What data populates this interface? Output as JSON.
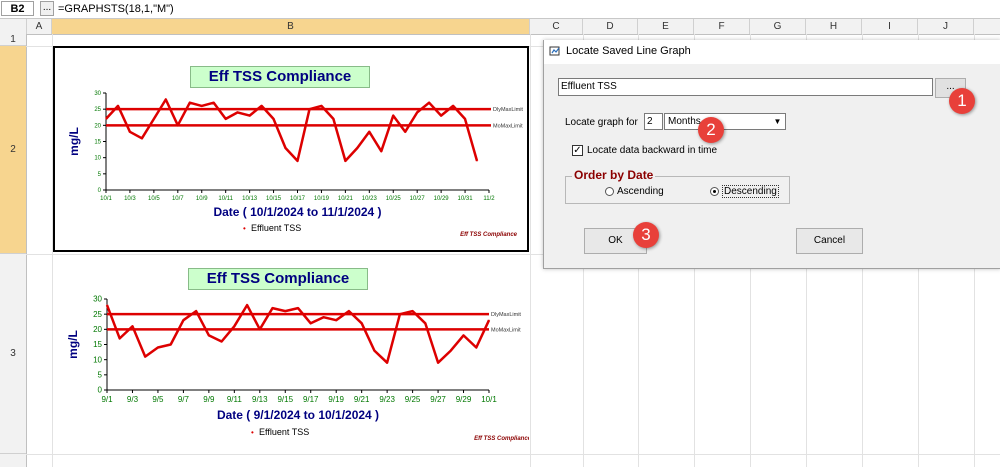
{
  "formula_bar": {
    "cell_ref": "B2",
    "button_label": "...",
    "formula": "=GRAPHSTS(18,1,\"M\")"
  },
  "columns": [
    "A",
    "B",
    "C",
    "D",
    "E",
    "F",
    "G",
    "H",
    "I",
    "J"
  ],
  "rows": [
    "1",
    "2",
    "3"
  ],
  "chart_data": [
    {
      "type": "line",
      "title": "Eff TSS Compliance",
      "xlabel": "Date  ( 10/1/2024  to  11/1/2024 )",
      "ylabel": "mg/L",
      "x_ticks": [
        "10/1",
        "10/3",
        "10/5",
        "10/7",
        "10/9",
        "10/11",
        "10/13",
        "10/15",
        "10/17",
        "10/19",
        "10/21",
        "10/23",
        "10/25",
        "10/27",
        "10/29",
        "10/31",
        "11/2"
      ],
      "x": [
        1,
        2,
        3,
        4,
        5,
        6,
        7,
        8,
        9,
        10,
        11,
        12,
        13,
        14,
        15,
        16,
        17,
        18,
        19,
        20,
        21,
        22,
        23,
        24,
        25,
        26,
        27,
        28,
        29,
        30,
        31
      ],
      "ylim": [
        0,
        30
      ],
      "y_ticks": [
        "0",
        "5",
        "10",
        "15",
        "20",
        "25",
        "30"
      ],
      "series": [
        {
          "name": "Effluent TSS",
          "color": "#dd0000",
          "values": [
            22,
            26,
            18,
            16,
            22,
            28,
            20,
            27,
            26,
            27,
            22,
            24,
            23,
            26,
            22,
            13,
            9,
            25,
            26,
            22,
            9,
            13,
            18,
            12,
            23,
            18,
            24,
            27,
            23,
            26,
            22,
            9
          ]
        }
      ],
      "limits": [
        {
          "name": "DlyMaxLimit",
          "value": 25,
          "color": "#dd0000"
        },
        {
          "name": "MoMaxLimit",
          "value": 20,
          "color": "#dd0000"
        }
      ],
      "legend": "Effluent TSS",
      "footer": "Eff TSS Compliance"
    },
    {
      "type": "line",
      "title": "Eff TSS Compliance",
      "xlabel": "Date  ( 9/1/2024  to  10/1/2024 )",
      "ylabel": "mg/L",
      "x_ticks": [
        "9/1",
        "9/3",
        "9/5",
        "9/7",
        "9/9",
        "9/11",
        "9/13",
        "9/15",
        "9/17",
        "9/19",
        "9/21",
        "9/23",
        "9/25",
        "9/27",
        "9/29",
        "10/1"
      ],
      "ylim": [
        0,
        30
      ],
      "y_ticks": [
        "0",
        "5",
        "10",
        "15",
        "20",
        "25",
        "30"
      ],
      "series": [
        {
          "name": "Effluent TSS",
          "color": "#dd0000",
          "values": [
            28,
            17,
            21,
            11,
            14,
            15,
            23,
            26,
            18,
            16,
            21,
            28,
            20,
            27,
            26,
            27,
            22,
            24,
            23,
            26,
            22,
            13,
            9,
            25,
            26,
            22,
            9,
            13,
            18,
            14,
            23
          ]
        }
      ],
      "limits": [
        {
          "name": "DlyMaxLimit",
          "value": 25,
          "color": "#dd0000"
        },
        {
          "name": "MoMaxLimit",
          "value": 20,
          "color": "#dd0000"
        }
      ],
      "legend": "Effluent TSS",
      "footer": "Eff TSS Compliance"
    }
  ],
  "dialog": {
    "title": "Locate Saved Line Graph",
    "graph_name": "Effluent TSS",
    "browse_label": "...",
    "locate_label": "Locate graph for",
    "locate_count": "2",
    "locate_period": "Months",
    "backward_checked": true,
    "backward_label": "Locate data backward in time",
    "order_legend": "Order by Date",
    "ascending_label": "Ascending",
    "descending_label": "Descending",
    "selected_order": "Descending",
    "ok_label": "OK",
    "cancel_label": "Cancel"
  },
  "markers": [
    "1",
    "2",
    "3"
  ],
  "colors": {
    "chart_line": "#dd0000",
    "axis_text": "#000080",
    "tick_text": "#007700",
    "title_bg": "#ccffcc",
    "marker": "#e8403a",
    "legend_dark_red": "#8b0000"
  }
}
